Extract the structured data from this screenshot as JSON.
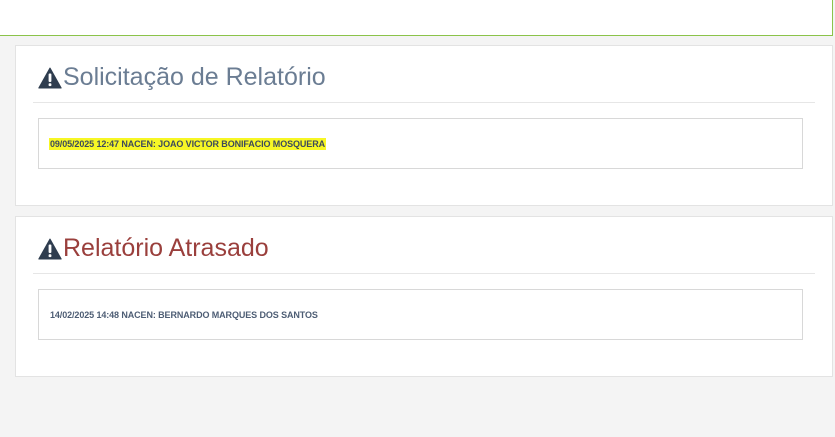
{
  "colors": {
    "top_strip_border": "#8bc34a",
    "solicitacao_title": "#6b7d93",
    "atrasado_title": "#9a3f3c",
    "highlight": "#f7f725",
    "icon": "#2f3d4f"
  },
  "solicitacao": {
    "icon": "warning-icon",
    "title": "Solicitação de Relatório",
    "items": [
      {
        "text": "09/05/2025 12:47 NACEN: JOAO VICTOR BONIFACIO MOSQUERA",
        "highlighted": true
      }
    ]
  },
  "atrasado": {
    "icon": "warning-icon",
    "title": "Relatório Atrasado",
    "items": [
      {
        "text": "14/02/2025 14:48 NACEN: BERNARDO MARQUES DOS SANTOS",
        "highlighted": false
      }
    ]
  }
}
